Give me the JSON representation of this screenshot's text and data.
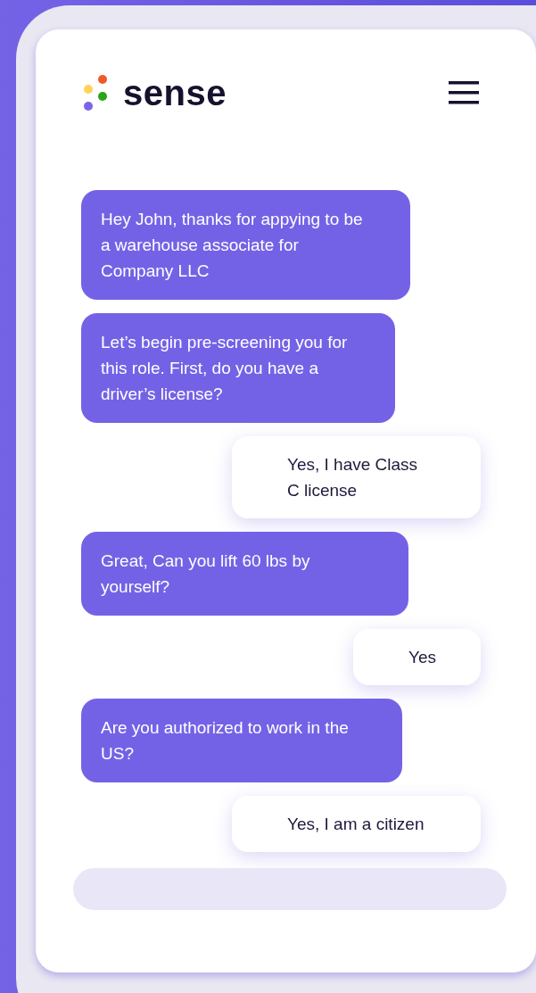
{
  "header": {
    "brand": "sense"
  },
  "messages": [
    {
      "kind": "bot",
      "text": "Hey John, thanks for appying to be a warehouse associate for Company LLC"
    },
    {
      "kind": "bot",
      "text": "Let’s begin pre-screening you for this role. First, do you have a driver’s license?"
    },
    {
      "kind": "user",
      "text": "Yes, I have Class C license"
    },
    {
      "kind": "bot",
      "text": "Great, Can you lift 60 lbs by yourself?"
    },
    {
      "kind": "user",
      "text": "Yes"
    },
    {
      "kind": "bot",
      "text": "Are you authorized to work in the US?"
    },
    {
      "kind": "user",
      "text": "Yes, I am a citizen"
    }
  ]
}
